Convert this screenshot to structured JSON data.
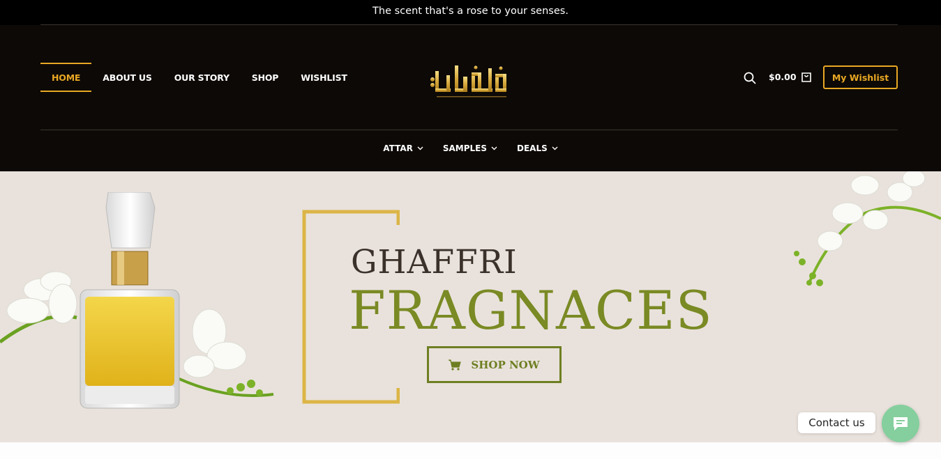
{
  "topbar": {
    "text": "The scent that's a rose to your senses."
  },
  "nav": {
    "items": [
      {
        "label": "HOME",
        "active": true
      },
      {
        "label": "ABOUT US"
      },
      {
        "label": "OUR STORY"
      },
      {
        "label": "SHOP"
      },
      {
        "label": "WISHLIST"
      }
    ]
  },
  "logo": {
    "alt": "Ghaffari logo"
  },
  "header": {
    "search_icon": "search-icon",
    "cart_total": "$0.00",
    "cart_icon": "shopping-bag-icon",
    "wishlist_button": "My Wishlist"
  },
  "subnav": {
    "items": [
      {
        "label": "ATTAR"
      },
      {
        "label": "SAMPLES"
      },
      {
        "label": "DEALS"
      }
    ]
  },
  "hero": {
    "title_line1": "GHAFFRI",
    "title_line2": "FRAGNACES",
    "button_label": "SHOP NOW",
    "button_icon": "cart-icon"
  },
  "contact": {
    "label": "Contact us",
    "icon": "chat-icon"
  },
  "colors": {
    "accent": "#e9a824",
    "olive": "#7a8a24",
    "header_bg": "#0d0906",
    "hero_bg": "#e9e2dc",
    "contact_green": "#84cf9d"
  }
}
